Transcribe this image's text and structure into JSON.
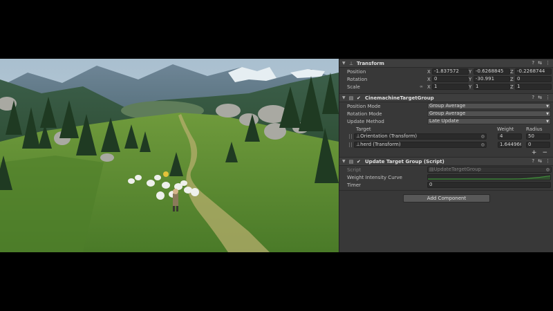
{
  "inspector": {
    "transform": {
      "title": "Transform",
      "position": {
        "label": "Position",
        "x": "-1.837572",
        "y": "-0.6268845",
        "z": "-0.2268744"
      },
      "rotation": {
        "label": "Rotation",
        "x": "0",
        "y": "-30.991",
        "z": "0"
      },
      "scale": {
        "label": "Scale",
        "x": "1",
        "y": "1",
        "z": "1"
      },
      "axis_labels": {
        "x": "X",
        "y": "Y",
        "z": "Z"
      }
    },
    "target_group": {
      "title": "CinemachineTargetGroup",
      "position_mode": {
        "label": "Position Mode",
        "value": "Group Average"
      },
      "rotation_mode": {
        "label": "Rotation Mode",
        "value": "Group Average"
      },
      "update_method": {
        "label": "Update Method",
        "value": "Late Update"
      },
      "columns": {
        "target": "Target",
        "weight": "Weight",
        "radius": "Radius"
      },
      "targets": [
        {
          "name": "Orientation (Transform)",
          "weight": "4",
          "radius": "50"
        },
        {
          "name": "herd (Transform)",
          "weight": "1.644966",
          "radius": "0"
        }
      ],
      "plus": "+",
      "minus": "−"
    },
    "update_script": {
      "title": "Update Target Group (Script)",
      "script": {
        "label": "Script",
        "value": "UpdateTargetGroup"
      },
      "curve": {
        "label": "Weight Intensity Curve",
        "color": "#3f8a3a"
      },
      "timer": {
        "label": "Timer",
        "value": "0"
      }
    },
    "add_component": "Add Component"
  },
  "colors": {
    "inspector_bg": "#383838",
    "field_bg": "#2a2a2a",
    "grass": "#5c8a2e",
    "sky": "#b8cad6"
  }
}
